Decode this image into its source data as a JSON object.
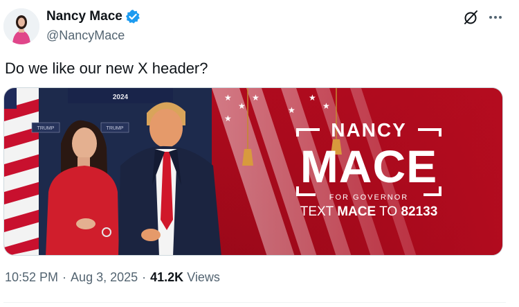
{
  "author": {
    "display_name": "Nancy Mace",
    "handle": "@NancyMace",
    "verified": true,
    "verified_color": "#1d9bf0"
  },
  "tweet": {
    "text": "Do we like our new X header?"
  },
  "media": {
    "banner_name_first": "NANCY",
    "banner_name_last": "MACE",
    "banner_for": "FOR GOVERNOR",
    "banner_text_prefix": "TEXT ",
    "banner_text_keyword": "MACE",
    "banner_text_mid": " TO ",
    "banner_text_number": "82133",
    "backdrop_year": "2024",
    "backdrop_small_1": "TRUMP",
    "backdrop_small_2": "TRUMP",
    "accent_red": "#c8102e"
  },
  "meta": {
    "time": "10:52 PM",
    "separator": "·",
    "date": "Aug 3, 2025",
    "views_count": "41.2K",
    "views_label": "Views"
  },
  "icons": {
    "grok": "grok-icon",
    "more": "more-icon",
    "verified": "verified-badge-icon"
  }
}
